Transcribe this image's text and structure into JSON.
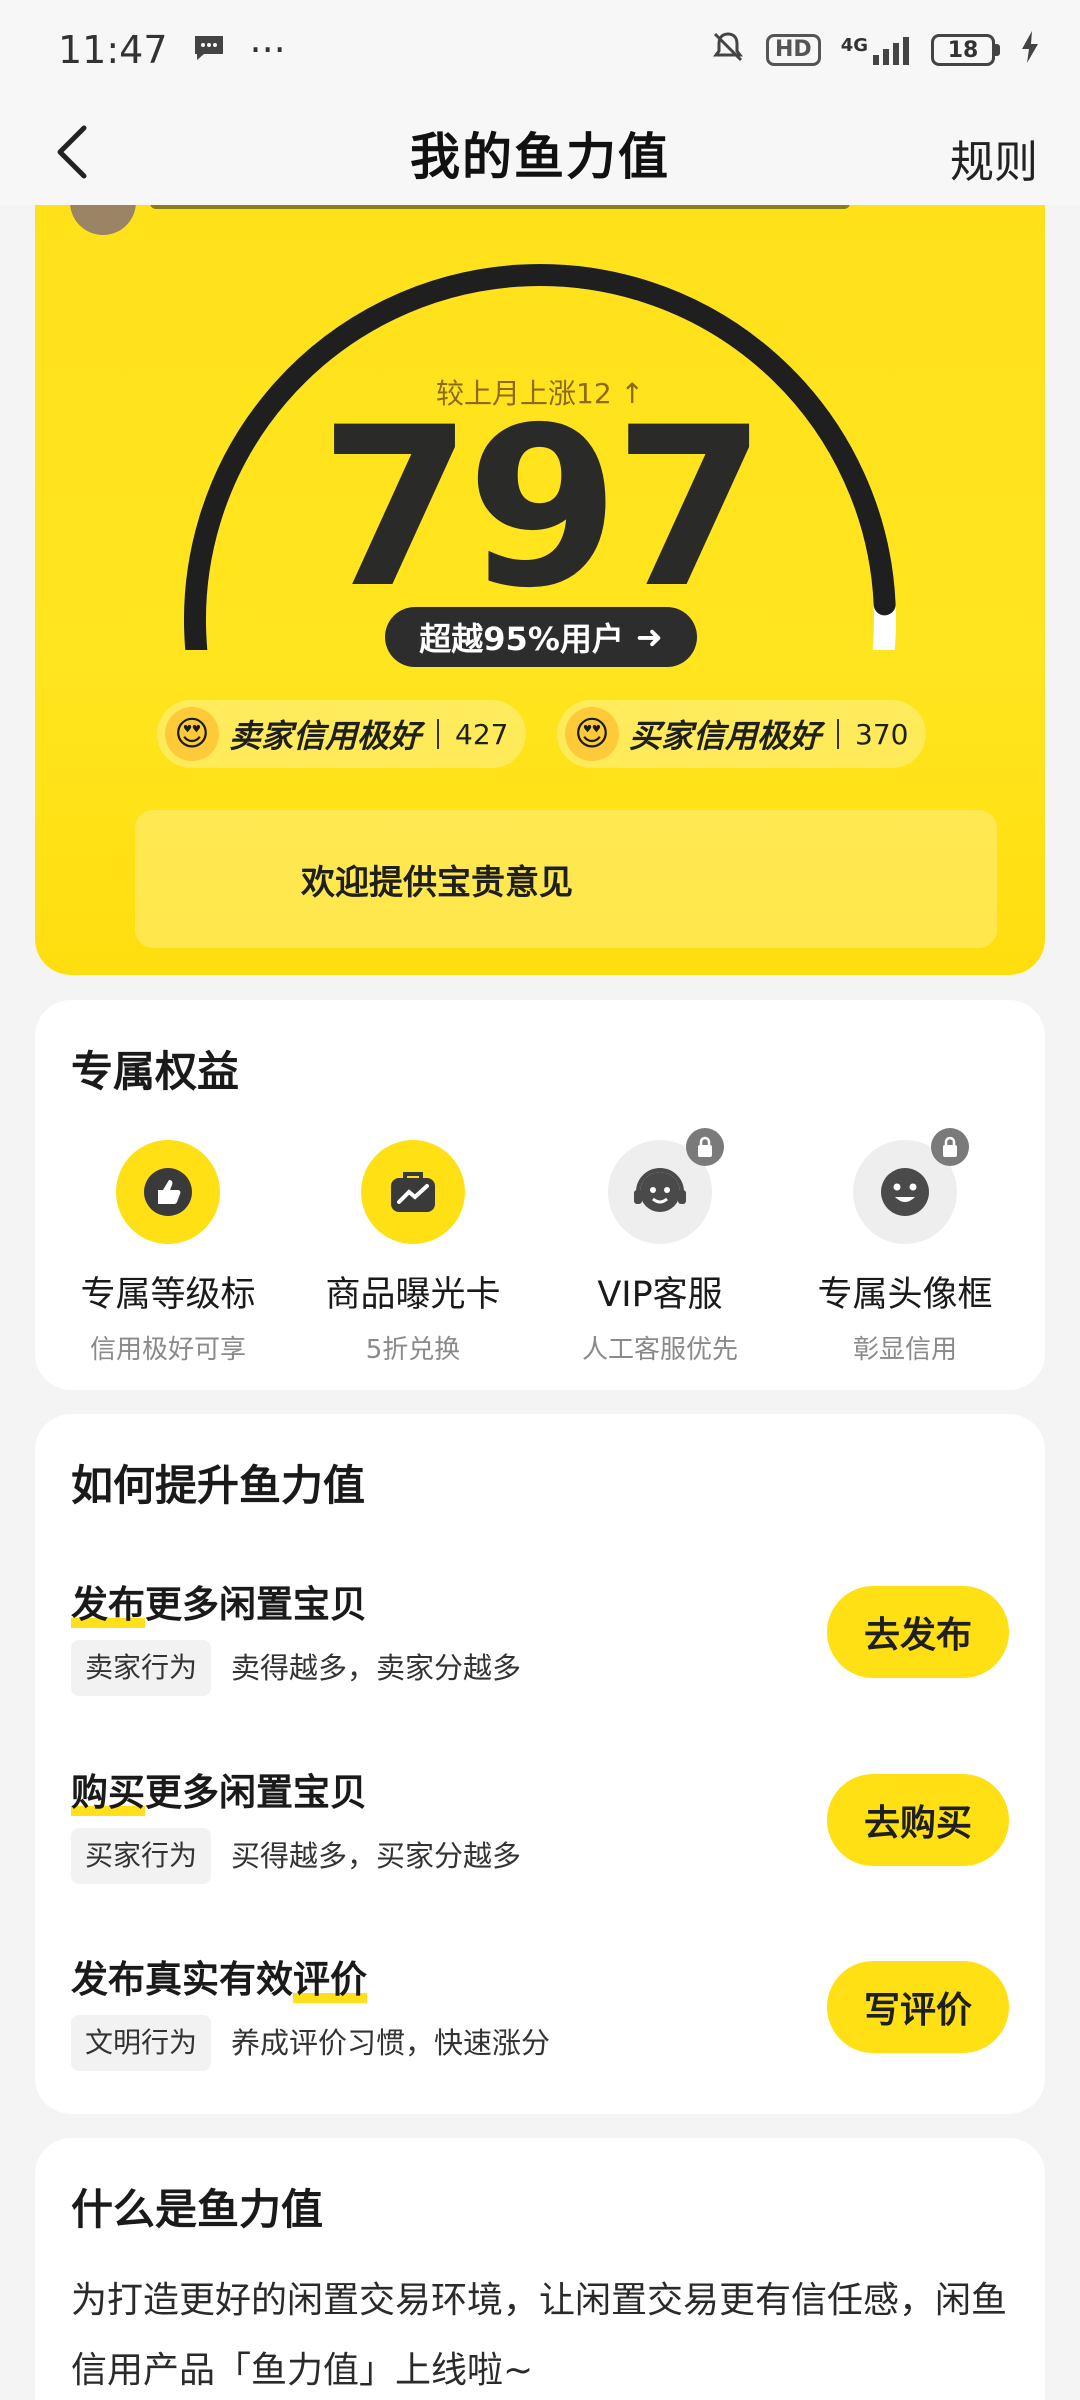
{
  "status_bar": {
    "time": "11:47",
    "more": "···",
    "hd": "HD",
    "network": "4G",
    "battery": "18"
  },
  "header": {
    "title": "我的鱼力值",
    "rules": "规则"
  },
  "score": {
    "change": "较上月上涨12 ↑",
    "value": "797",
    "progress": 0.96,
    "rank_text": "超越95%用户",
    "rank_arrow": "➜",
    "credits": [
      {
        "label": "卖家信用极好",
        "value": "427",
        "emoji": "😍"
      },
      {
        "label": "买家信用极好",
        "value": "370",
        "emoji": "😍"
      }
    ],
    "feedback": "欢迎提供宝贵意见"
  },
  "benefits": {
    "title": "专属权益",
    "items": [
      {
        "title": "专属等级标",
        "sub": "信用极好可享",
        "icon": "thumbs-up-icon",
        "locked": false
      },
      {
        "title": "商品曝光卡",
        "sub": "5折兑换",
        "icon": "trending-bag-icon",
        "locked": false
      },
      {
        "title": "VIP客服",
        "sub": "人工客服优先",
        "icon": "headset-icon",
        "locked": true
      },
      {
        "title": "专属头像框",
        "sub": "彰显信用",
        "icon": "smiley-frame-icon",
        "locked": true
      }
    ]
  },
  "improve": {
    "title": "如何提升鱼力值",
    "tasks": [
      {
        "title_hl": "发布",
        "title_rest": "更多闲置宝贝",
        "tag": "卖家行为",
        "desc": "卖得越多，卖家分越多",
        "button": "去发布"
      },
      {
        "title_hl": "购买",
        "title_rest": "更多闲置宝贝",
        "tag": "买家行为",
        "desc": "买得越多，买家分越多",
        "button": "去购买"
      },
      {
        "title_pre": "发布真实有效",
        "title_hl": "评价",
        "tag": "文明行为",
        "desc": "养成评价习惯，快速涨分",
        "button": "写评价"
      }
    ]
  },
  "about": {
    "title": "什么是鱼力值",
    "text": "为打造更好的闲置交易环境，让闲置交易更有信任感，闲鱼信用产品「鱼力值」上线啦~"
  },
  "colors": {
    "brand_yellow": "#ffe014",
    "dark": "#2d2d2d"
  }
}
